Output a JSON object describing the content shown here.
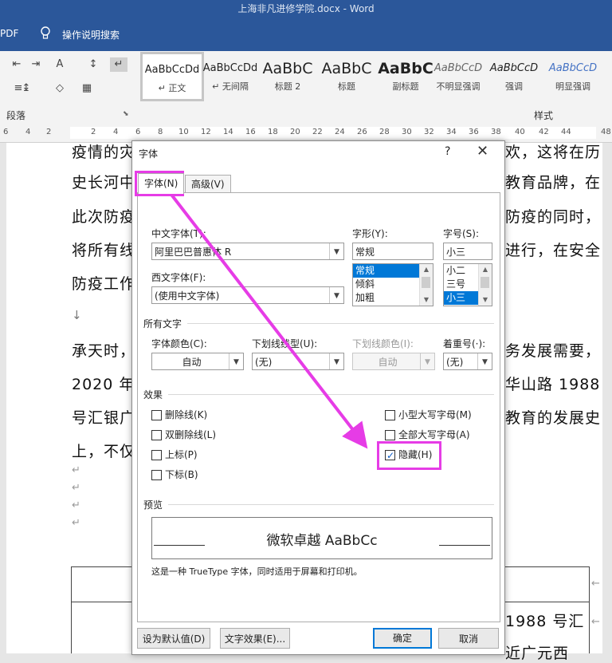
{
  "window": {
    "title": "上海非凡进修学院.docx  -  Word"
  },
  "tellbar": {
    "pdf_label": "PDF",
    "tell_me": "操作说明搜索"
  },
  "ribbon": {
    "paragraph_group_label": "段落",
    "styles_group_label": "样式",
    "styles": [
      {
        "preview": "AaBbCcDd",
        "name": "↵ 正文"
      },
      {
        "preview": "AaBbCcDd",
        "name": "↵ 无间隔"
      },
      {
        "preview": "AaBbC",
        "name": "标题 2"
      },
      {
        "preview": "AaBbC",
        "name": "标题"
      },
      {
        "preview": "AaBbC",
        "name": "副标题"
      },
      {
        "preview": "AaBbCcD",
        "name": "不明显强调"
      },
      {
        "preview": "AaBbCcD",
        "name": "强调"
      },
      {
        "preview": "AaBbCcD",
        "name": "明显强调"
      }
    ]
  },
  "ruler": {
    "ticks": [
      "6",
      "4",
      "2",
      "2",
      "4",
      "6",
      "8",
      "10",
      "12",
      "14",
      "16",
      "18",
      "20",
      "22",
      "24",
      "26",
      "28",
      "30",
      "32",
      "34",
      "36",
      "38",
      "40",
      "42",
      "44",
      "48"
    ]
  },
  "document": {
    "lines": [
      {
        "left": "疫情的灾",
        "right": "欢，这将在历"
      },
      {
        "left": "史长河中",
        "right": "教育品牌，在"
      },
      {
        "left": "此次防疫",
        "right": "防疫的同时，"
      },
      {
        "left": "将所有线",
        "right": "进行，在安全"
      },
      {
        "left": "防疫工作",
        "right": ""
      },
      {
        "left": "承天时，",
        "right": "务发展需要，"
      },
      {
        "left": "2020 年",
        "right": "华山路 1988"
      },
      {
        "left": "号汇银广",
        "right": "教育的发展史"
      },
      {
        "left": "上，不仅",
        "right": ""
      }
    ],
    "table_text_1": "1988 号汇",
    "table_text_2": "近广元西"
  },
  "dialog": {
    "title": "字体",
    "help": "?",
    "close": "✕",
    "tabs": [
      {
        "label": "字体(N)",
        "active": true
      },
      {
        "label": "高级(V)",
        "active": false
      }
    ],
    "cn_font_label": "中文字体(T):",
    "cn_font_value": "阿里巴巴普惠体 R",
    "west_font_label": "西文字体(F):",
    "west_font_value": "(使用中文字体)",
    "style_label": "字形(Y):",
    "style_value": "常规",
    "style_options": [
      "常规",
      "倾斜",
      "加粗"
    ],
    "style_selected": "常规",
    "size_label": "字号(S):",
    "size_value": "小三",
    "size_options": [
      "小二",
      "三号",
      "小三"
    ],
    "size_selected": "小三",
    "all_text_header": "所有文字",
    "font_color_label": "字体颜色(C):",
    "font_color_value": "自动",
    "underline_type_label": "下划线线型(U):",
    "underline_type_value": "(无)",
    "underline_color_label": "下划线颜色(I):",
    "underline_color_value": "自动",
    "emphasis_label": "着重号(·):",
    "emphasis_value": "(无)",
    "effects_header": "效果",
    "effects": [
      {
        "label": "删除线(K)",
        "checked": false
      },
      {
        "label": "双删除线(L)",
        "checked": false
      },
      {
        "label": "上标(P)",
        "checked": false
      },
      {
        "label": "下标(B)",
        "checked": false
      },
      {
        "label": "小型大写字母(M)",
        "checked": false
      },
      {
        "label": "全部大写字母(A)",
        "checked": false
      },
      {
        "label": "隐藏(H)",
        "checked": true
      }
    ],
    "preview_header": "预览",
    "preview_text": "微软卓越  AaBbCc",
    "truetype_note": "这是一种 TrueType 字体，同时适用于屏幕和打印机。",
    "buttons": {
      "set_default": "设为默认值(D)",
      "text_effects": "文字效果(E)...",
      "ok": "确定",
      "cancel": "取消"
    }
  },
  "annotation": {
    "color": "#e63ce6"
  }
}
